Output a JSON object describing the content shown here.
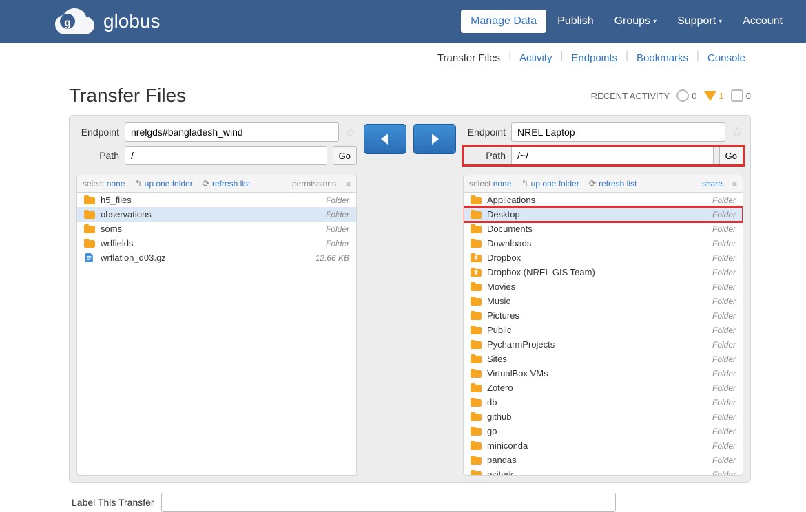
{
  "brand": "globus",
  "nav": {
    "items": [
      {
        "label": "Manage Data",
        "active": true,
        "dropdown": false
      },
      {
        "label": "Publish",
        "active": false,
        "dropdown": false
      },
      {
        "label": "Groups",
        "active": false,
        "dropdown": true
      },
      {
        "label": "Support",
        "active": false,
        "dropdown": true
      },
      {
        "label": "Account",
        "active": false,
        "dropdown": false
      }
    ]
  },
  "subnav": {
    "items": [
      {
        "label": "Transfer Files",
        "active": true
      },
      {
        "label": "Activity",
        "active": false
      },
      {
        "label": "Endpoints",
        "active": false
      },
      {
        "label": "Bookmarks",
        "active": false
      },
      {
        "label": "Console",
        "active": false
      }
    ]
  },
  "page_title": "Transfer Files",
  "recent_activity": {
    "label": "RECENT ACTIVITY",
    "circle": "0",
    "triangle": "1",
    "octagon": "0"
  },
  "left": {
    "endpoint_label": "Endpoint",
    "endpoint_value": "nrelgds#bangladesh_wind",
    "path_label": "Path",
    "path_value": "/",
    "go": "Go",
    "toolbar": {
      "select": "select",
      "none": "none",
      "up": "up one folder",
      "refresh": "refresh list",
      "extra": "permissions"
    },
    "files": [
      {
        "name": "h5_files",
        "type": "Folder",
        "icon": "folder",
        "selected": false
      },
      {
        "name": "observations",
        "type": "Folder",
        "icon": "folder",
        "selected": true
      },
      {
        "name": "soms",
        "type": "Folder",
        "icon": "folder",
        "selected": false
      },
      {
        "name": "wrffields",
        "type": "Folder",
        "icon": "folder",
        "selected": false
      },
      {
        "name": "wrflatlon_d03.gz",
        "type": "12.66 KB",
        "icon": "file",
        "selected": false
      }
    ]
  },
  "right": {
    "endpoint_label": "Endpoint",
    "endpoint_value": "NREL Laptop",
    "path_label": "Path",
    "path_value": "/~/",
    "go": "Go",
    "toolbar": {
      "select": "select",
      "none": "none",
      "up": "up one folder",
      "refresh": "refresh list",
      "extra": "share"
    },
    "files": [
      {
        "name": "Applications",
        "type": "Folder",
        "icon": "folder",
        "selected": false
      },
      {
        "name": "Desktop",
        "type": "Folder",
        "icon": "folder",
        "selected": true,
        "highlight": true
      },
      {
        "name": "Documents",
        "type": "Folder",
        "icon": "folder",
        "selected": false
      },
      {
        "name": "Downloads",
        "type": "Folder",
        "icon": "folder",
        "selected": false
      },
      {
        "name": "Dropbox",
        "type": "Folder",
        "icon": "dropbox",
        "selected": false
      },
      {
        "name": "Dropbox (NREL GIS Team)",
        "type": "Folder",
        "icon": "dropbox",
        "selected": false
      },
      {
        "name": "Movies",
        "type": "Folder",
        "icon": "folder",
        "selected": false
      },
      {
        "name": "Music",
        "type": "Folder",
        "icon": "folder",
        "selected": false
      },
      {
        "name": "Pictures",
        "type": "Folder",
        "icon": "folder",
        "selected": false
      },
      {
        "name": "Public",
        "type": "Folder",
        "icon": "folder",
        "selected": false
      },
      {
        "name": "PycharmProjects",
        "type": "Folder",
        "icon": "folder",
        "selected": false
      },
      {
        "name": "Sites",
        "type": "Folder",
        "icon": "folder",
        "selected": false
      },
      {
        "name": "VirtualBox VMs",
        "type": "Folder",
        "icon": "folder",
        "selected": false
      },
      {
        "name": "Zotero",
        "type": "Folder",
        "icon": "folder",
        "selected": false
      },
      {
        "name": "db",
        "type": "Folder",
        "icon": "folder",
        "selected": false
      },
      {
        "name": "github",
        "type": "Folder",
        "icon": "folder",
        "selected": false
      },
      {
        "name": "go",
        "type": "Folder",
        "icon": "folder",
        "selected": false
      },
      {
        "name": "miniconda",
        "type": "Folder",
        "icon": "folder",
        "selected": false
      },
      {
        "name": "pandas",
        "type": "Folder",
        "icon": "folder",
        "selected": false
      },
      {
        "name": "psiturk",
        "type": "Folder",
        "icon": "folder",
        "selected": false
      }
    ]
  },
  "label_transfer": {
    "label": "Label This Transfer",
    "value": ""
  }
}
